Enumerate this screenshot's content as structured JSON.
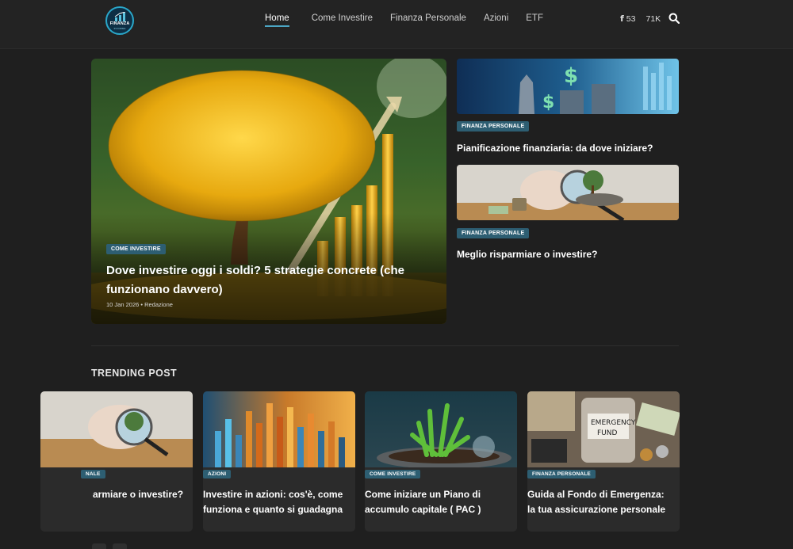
{
  "header": {
    "logo_text": "FINANZA",
    "logo_sub": "IN FORMA",
    "nav": [
      "Home",
      "Come Investire",
      "Finanza Personale",
      "Azioni",
      "ETF"
    ],
    "facebook_count": "53",
    "followers_count": "71K"
  },
  "hero": {
    "category": "COME INVESTIRE",
    "title": "Dove investire oggi i soldi? 5 strategie concrete (che funzionano davvero)",
    "meta": "10 Jan 2026 • Redazione"
  },
  "side": [
    {
      "category": "FINANZA PERSONALE",
      "title": "Pianificazione finanziaria: da dove iniziare?"
    },
    {
      "category": "FINANZA PERSONALE",
      "title": "Meglio risparmiare o investire?"
    }
  ],
  "trending": {
    "heading": "TRENDING POST",
    "cards": [
      {
        "category": "NALE",
        "title": "armiare o investire?"
      },
      {
        "category": "AZIONI",
        "title": "Investire in azioni: cos'è, come funziona e quanto si guadagna"
      },
      {
        "category": "COME INVESTIRE",
        "title": "Come iniziare un Piano di accumulo capitale ( PAC )"
      },
      {
        "category": "FINANZA PERSONALE",
        "title": "Guida al Fondo di Emergenza: la tua assicurazione personale"
      }
    ]
  },
  "colors": {
    "accent": "#4ca6c4",
    "badge": "#2d5e72",
    "background": "#1f1f1f",
    "card": "#2b2b2b"
  },
  "icons": [
    "facebook-icon",
    "search-icon",
    "chart-logo-icon"
  ]
}
